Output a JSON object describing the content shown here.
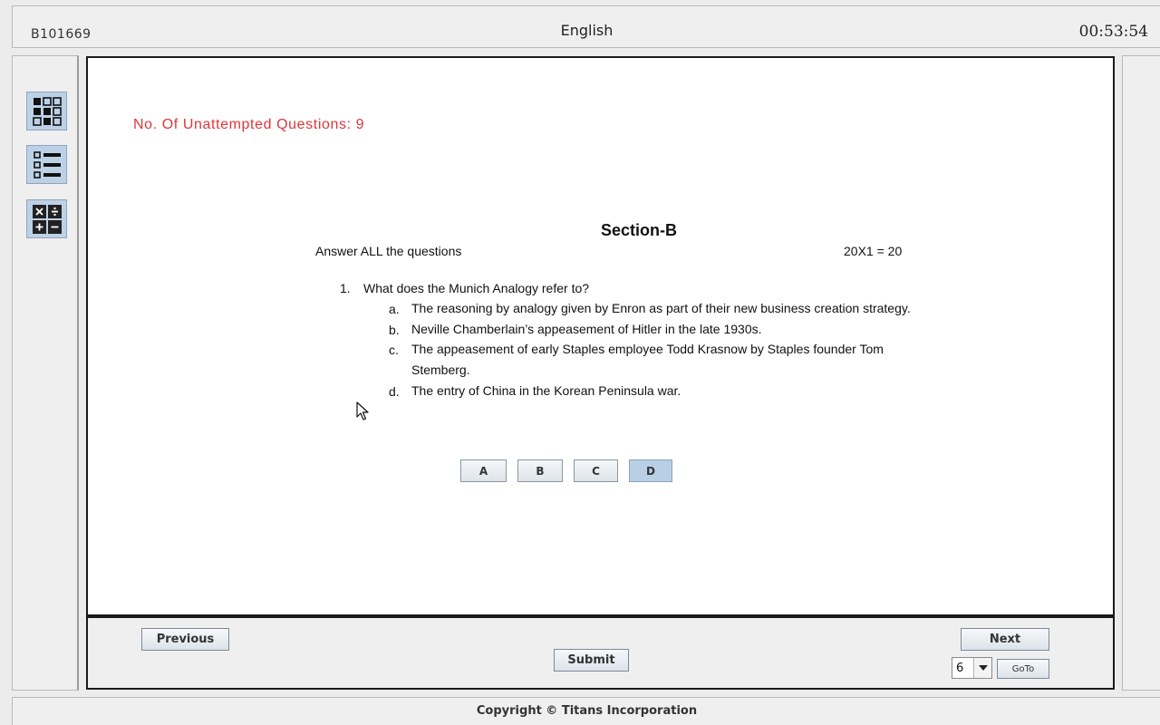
{
  "header": {
    "roll_number": "B101669",
    "subject": "English",
    "timer": "00:53:54"
  },
  "sidebar": {
    "items": [
      {
        "name": "question-grid",
        "icon": "grid-icon"
      },
      {
        "name": "question-list",
        "icon": "list-icon"
      },
      {
        "name": "calculator",
        "icon": "calculator-icon"
      }
    ]
  },
  "main": {
    "unattempted": "No. Of Unattempted Questions: 9",
    "section_title": "Section-B",
    "instruction": "Answer ALL the questions",
    "marks": "20X1 = 20",
    "question": {
      "number": "1.",
      "text": "What does the Munich Analogy refer to?",
      "options": [
        {
          "letter": "a.",
          "text": "The reasoning by analogy given by Enron as part of their new business creation strategy."
        },
        {
          "letter": "b.",
          "text": "Neville Chamberlain’s appeasement of Hitler in the late 1930s."
        },
        {
          "letter": "c.",
          "text": "The appeasement of early Staples employee Todd Krasnow by Staples founder Tom Stemberg."
        },
        {
          "letter": "d.",
          "text": "The entry of China in the Korean Peninsula war."
        }
      ]
    },
    "answer_buttons": [
      "A",
      "B",
      "C",
      "D"
    ],
    "selected_answer": "D"
  },
  "nav": {
    "previous_label": "Previous",
    "submit_label": "Submit",
    "next_label": "Next",
    "goto_value": "6",
    "goto_label": "GoTo"
  },
  "footer": {
    "copyright": "Copyright  © Titans Incorporation"
  },
  "colors": {
    "unattempted_text": "#e0353a",
    "selected_button": "#b9cfe6",
    "sidebar_button": "#bdd1e6"
  }
}
